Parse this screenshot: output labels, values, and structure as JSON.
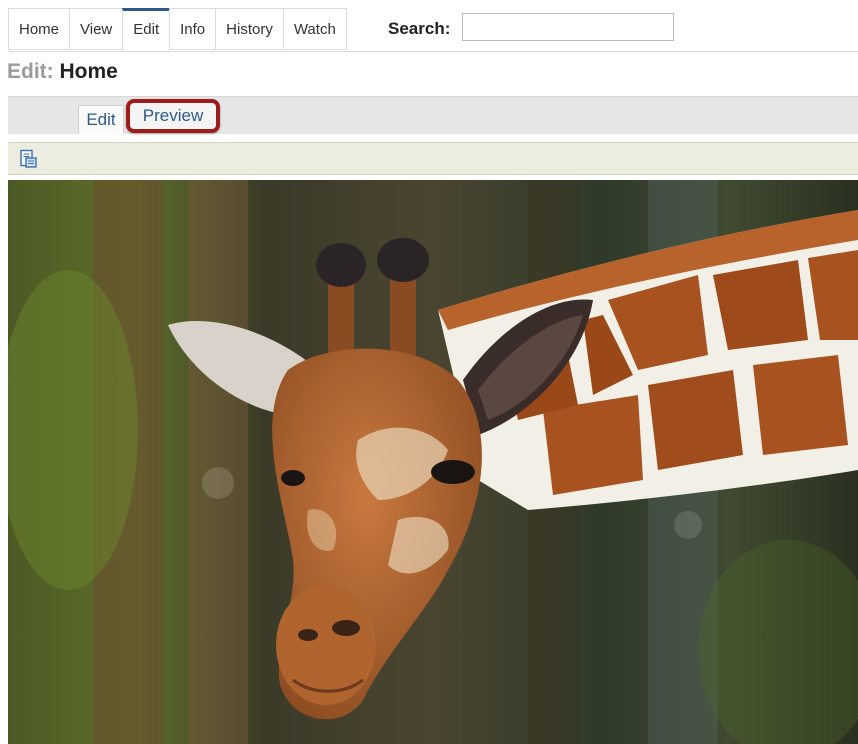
{
  "tabs": [
    {
      "label": "Home",
      "active": false
    },
    {
      "label": "View",
      "active": false
    },
    {
      "label": "Edit",
      "active": true
    },
    {
      "label": "Info",
      "active": false
    },
    {
      "label": "History",
      "active": false
    },
    {
      "label": "Watch",
      "active": false
    }
  ],
  "search": {
    "label": "Search:",
    "value": ""
  },
  "page_title": {
    "prefix": "Edit:",
    "name": "Home"
  },
  "subtabs": [
    {
      "label": "Edit"
    },
    {
      "label": "Preview",
      "highlighted": true
    }
  ],
  "toolbar": {
    "icon": "document-preview-icon"
  },
  "preview": {
    "image_icon": "giraffe-photo-icon"
  },
  "colors": {
    "accent": "#2e5a8a",
    "highlight": "#9e1c1c"
  }
}
